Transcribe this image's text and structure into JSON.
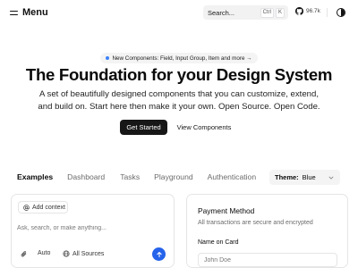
{
  "header": {
    "menu_label": "Menu",
    "search": {
      "label": "Search...",
      "kbd_ctrl": "Ctrl",
      "kbd_key": "K"
    },
    "github": {
      "stars": "96.7k"
    }
  },
  "hero": {
    "announcement": "New Components: Field, Input Group, Item and more →",
    "title": "The Foundation for your Design System",
    "subtitle": "A set of beautifully designed components that you can customize, extend, and build on. Start here then make it your own. Open Source. Open Code.",
    "primary_button": "Get Started",
    "secondary_button": "View Components"
  },
  "tabs": [
    {
      "label": "Examples",
      "active": true
    },
    {
      "label": "Dashboard",
      "active": false
    },
    {
      "label": "Tasks",
      "active": false
    },
    {
      "label": "Playground",
      "active": false
    },
    {
      "label": "Authentication",
      "active": false
    }
  ],
  "theme_select": {
    "label": "Theme:",
    "value": "Blue"
  },
  "chat_card": {
    "add_context": "Add context",
    "placeholder": "Ask, search, or make anything...",
    "mode": "Auto",
    "sources": "All Sources"
  },
  "payment_card": {
    "title": "Payment Method",
    "description": "All transactions are secure and encrypted",
    "name_label": "Name on Card",
    "name_placeholder": "John Doe"
  },
  "colors": {
    "accent": "#2563eb",
    "primary_button": "#171717",
    "announcement_dot": "#3b82f6"
  }
}
